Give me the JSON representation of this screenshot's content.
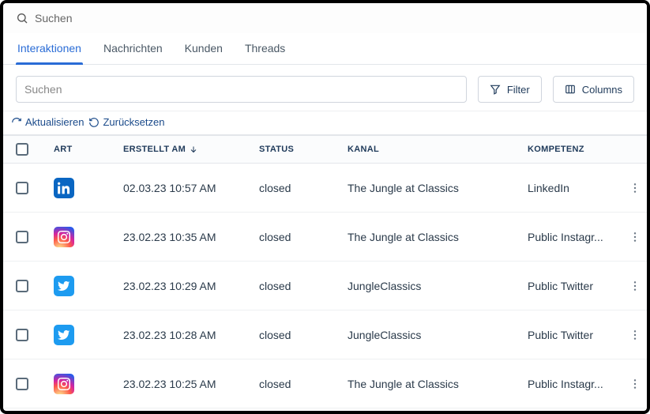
{
  "top_search": {
    "placeholder": "Suchen"
  },
  "tabs": [
    {
      "label": "Interaktionen",
      "active": true
    },
    {
      "label": "Nachrichten",
      "active": false
    },
    {
      "label": "Kunden",
      "active": false
    },
    {
      "label": "Threads",
      "active": false
    }
  ],
  "toolbar": {
    "search_placeholder": "Suchen",
    "filter_label": "Filter",
    "columns_label": "Columns"
  },
  "actions": {
    "refresh_label": "Aktualisieren",
    "reset_label": "Zurücksetzen"
  },
  "columns": {
    "art": "ART",
    "erstellt_am": "ERSTELLT AM",
    "status": "STATUS",
    "kanal": "KANAL",
    "kompetenz": "KOMPETENZ"
  },
  "sort": {
    "column": "erstellt_am",
    "dir": "desc"
  },
  "rows": [
    {
      "art": "linkedin",
      "erstellt_am": "02.03.23 10:57 AM",
      "status": "closed",
      "kanal": "The Jungle at Classics",
      "kompetenz": "LinkedIn"
    },
    {
      "art": "instagram",
      "erstellt_am": "23.02.23 10:35 AM",
      "status": "closed",
      "kanal": "The Jungle at Classics",
      "kompetenz": "Public Instagr..."
    },
    {
      "art": "twitter",
      "erstellt_am": "23.02.23 10:29 AM",
      "status": "closed",
      "kanal": "JungleClassics",
      "kompetenz": "Public Twitter"
    },
    {
      "art": "twitter",
      "erstellt_am": "23.02.23 10:28 AM",
      "status": "closed",
      "kanal": "JungleClassics",
      "kompetenz": "Public Twitter"
    },
    {
      "art": "instagram",
      "erstellt_am": "23.02.23 10:25 AM",
      "status": "closed",
      "kanal": "The Jungle at Classics",
      "kompetenz": "Public Instagr..."
    }
  ]
}
